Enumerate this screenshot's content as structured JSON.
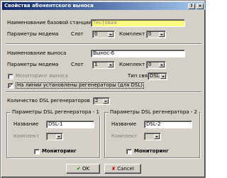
{
  "window": {
    "title": "Свойства абонентского выноса"
  },
  "station": {
    "name_label": "Наименование базовой станции",
    "name_value": "Тестовая",
    "modem_label": "Параметры модема",
    "slot_label": "Слот",
    "slot_value": "0",
    "set_label": "Комплект",
    "set_value": "0"
  },
  "remote": {
    "name_label": "Наименование выноса",
    "name_value": "Вынос-6",
    "modem_label": "Параметры модема",
    "slot_label": "Слот",
    "slot_value": "1",
    "set_label": "Комплект",
    "set_value": "0",
    "monitoring_label": "Мониторинг выноса",
    "link_type_label": "Тип связи",
    "link_type_value": "DSL",
    "regen_label": "На линии установлены регенераторы (для DSL)"
  },
  "regen_count": {
    "label": "Количество DSL регенераторов",
    "value": "2"
  },
  "regen1": {
    "title": "Параметры DSL регенератора - 1",
    "name_label": "Название",
    "name_value": "DSL-1",
    "set_label": "Комплект",
    "set_value": "",
    "monitoring_label": "Мониторинг"
  },
  "regen2": {
    "title": "Параметры DSL регенератора - 2",
    "name_label": "Название",
    "name_value": "DSL-2",
    "set_label": "Комплект",
    "set_value": "",
    "monitoring_label": "Мониторинг"
  },
  "buttons": {
    "ok_label": "OK",
    "cancel_label": "Cancel"
  }
}
